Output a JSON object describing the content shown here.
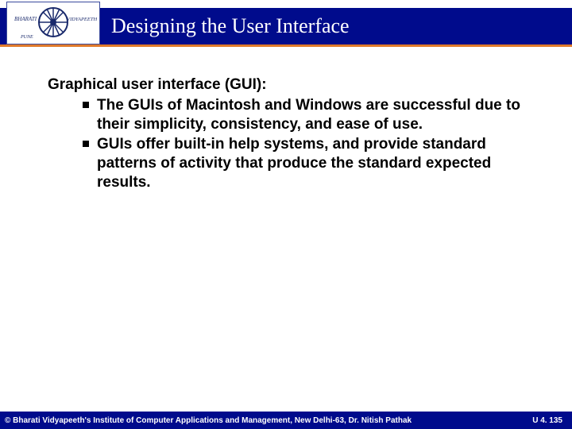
{
  "header": {
    "title": "Designing the User Interface"
  },
  "body": {
    "heading": "Graphical user interface (GUI):",
    "bullets": [
      "The GUIs of Macintosh and Windows are successful due to their simplicity, consistency, and ease of use.",
      "GUIs offer built-in help systems, and provide standard patterns of activity that produce the standard expected results."
    ]
  },
  "footer": {
    "copyright": "© Bharati Vidyapeeth's Institute of Computer Applications and Management, New Delhi-63, Dr. Nitish Pathak",
    "pageref": "U 4. 135"
  }
}
